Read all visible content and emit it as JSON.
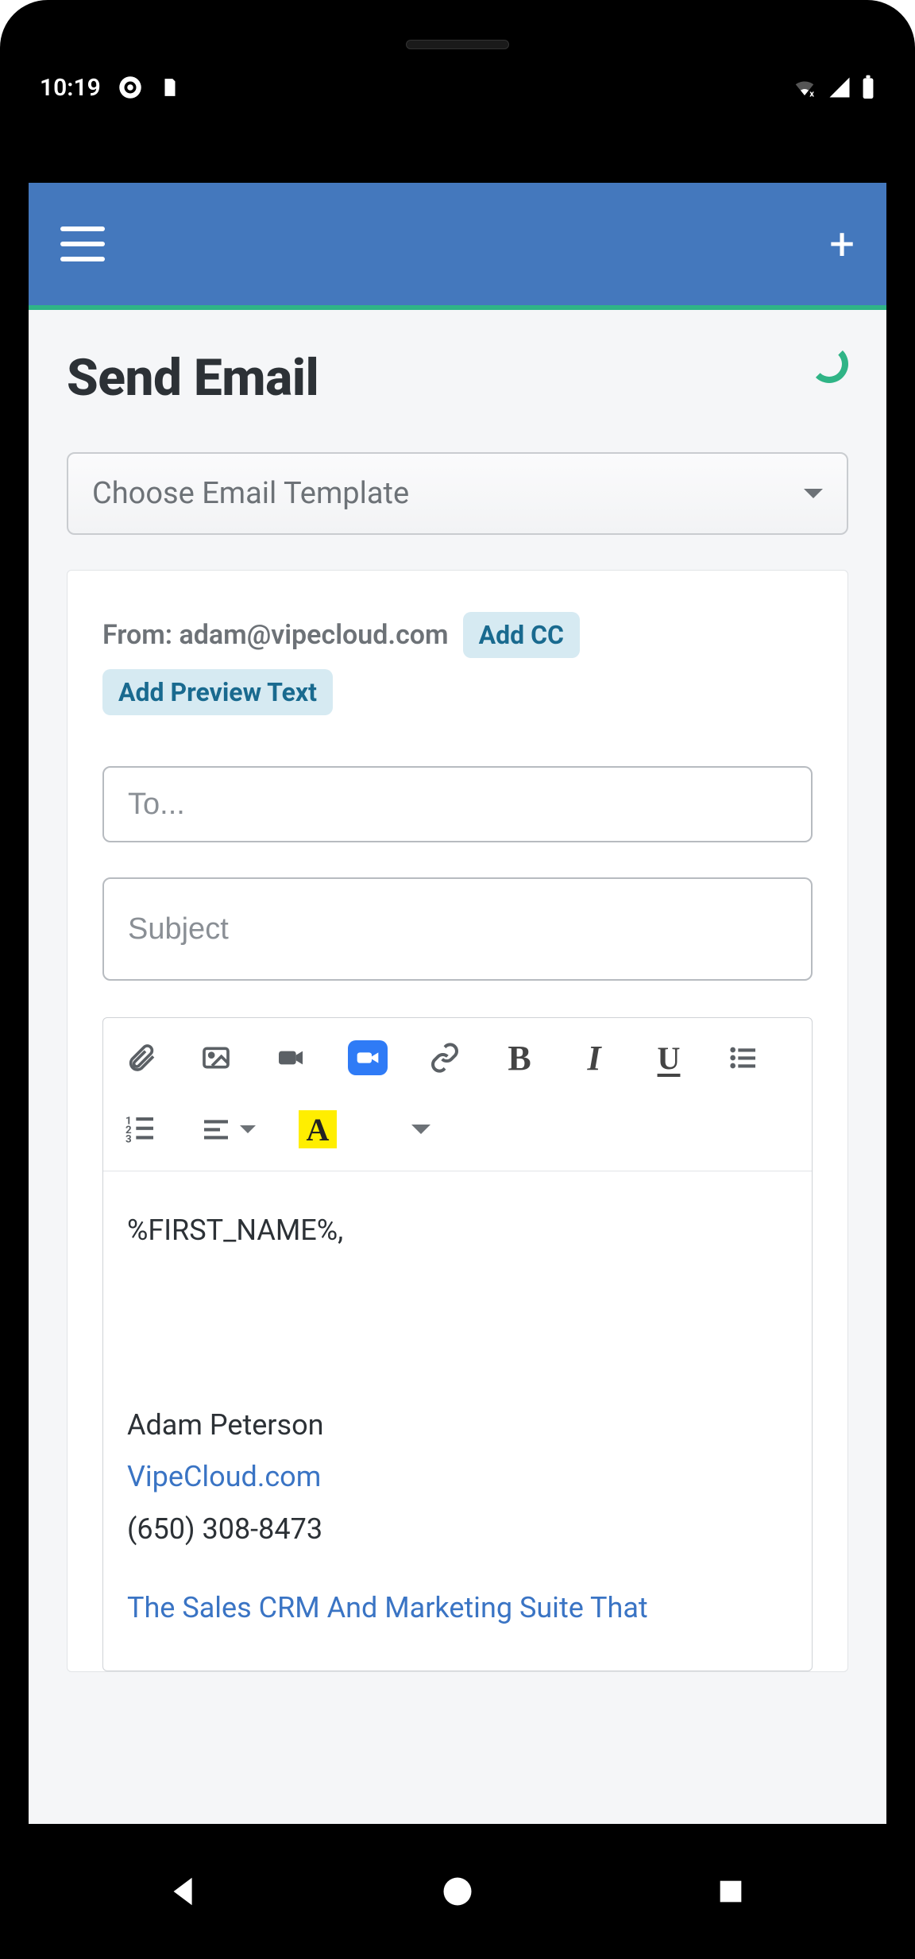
{
  "status": {
    "time": "10:19"
  },
  "header": {},
  "page": {
    "title": "Send Email",
    "template_placeholder": "Choose Email Template"
  },
  "compose": {
    "from_label": "From: adam@vipecloud.com",
    "add_cc_label": "Add CC",
    "add_preview_label": "Add Preview Text",
    "to_placeholder": "To...",
    "subject_placeholder": "Subject"
  },
  "body": {
    "greeting": "%FIRST_NAME%,",
    "sig_name": "Adam Peterson",
    "sig_link": "VipeCloud.com",
    "sig_phone": "(650) 308-8473",
    "sig_tagline": "The Sales CRM And Marketing Suite That"
  }
}
